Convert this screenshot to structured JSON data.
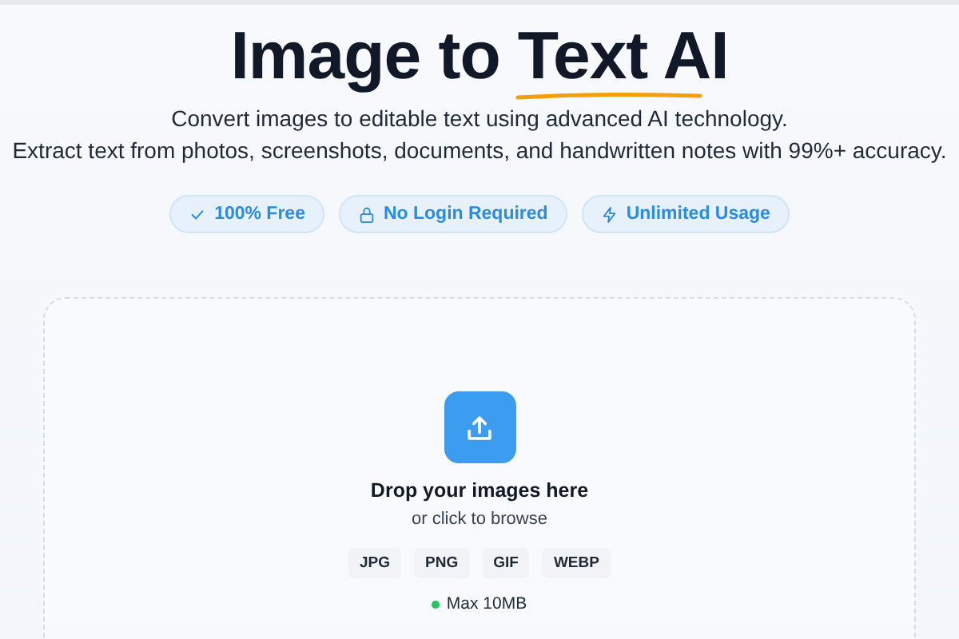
{
  "hero": {
    "title": "Image to",
    "title_highlight": "Text AI",
    "subtitle_lines": [
      "Convert images to editable text using advanced AI technology.",
      "Extract text from photos, screenshots, documents, and handwritten notes with 99%+ accuracy."
    ]
  },
  "badges": [
    {
      "kind": "check",
      "label": "100% Free"
    },
    {
      "kind": "lock",
      "label": "No Login Required"
    },
    {
      "kind": "bolt",
      "label": "Unlimited Usage"
    }
  ],
  "dropzone": {
    "heading": "Drop your images here",
    "hint": "or click to browse",
    "formats": [
      "JPG",
      "PNG",
      "GIF",
      "WEBP"
    ],
    "limit": "Max 10MB"
  }
}
